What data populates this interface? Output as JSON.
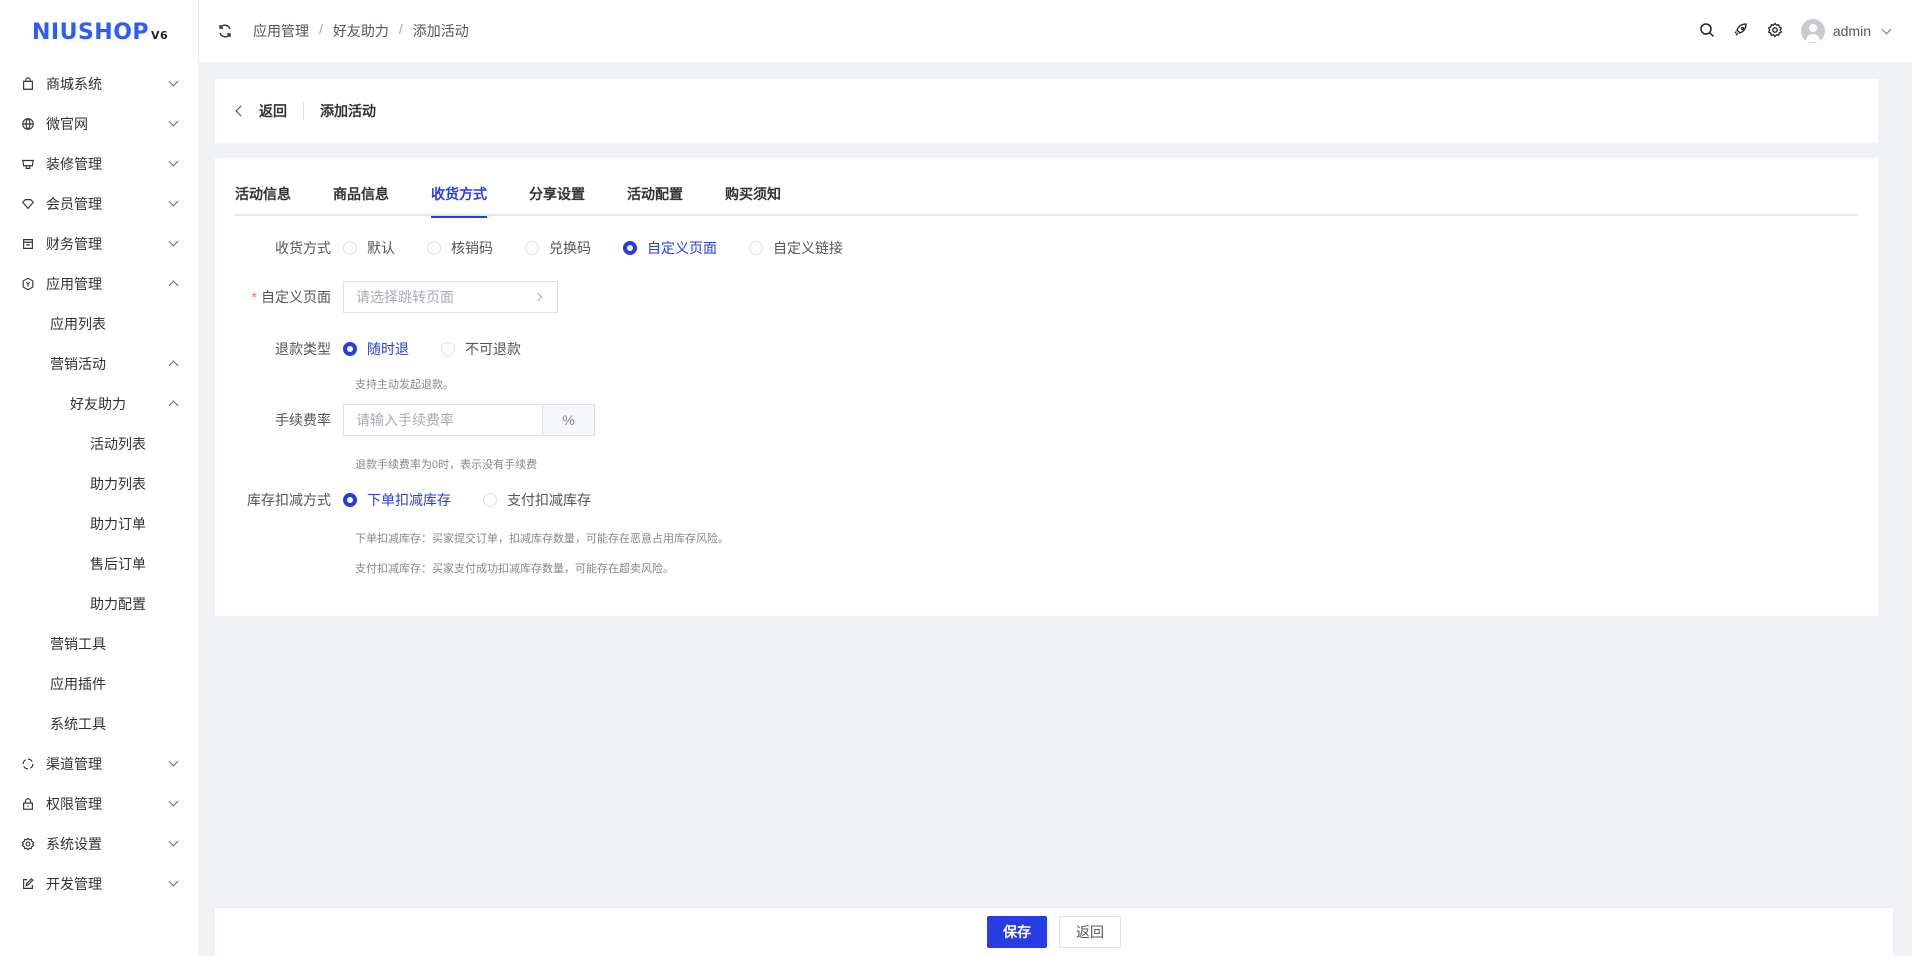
{
  "logo": {
    "text": "NIUSHOP",
    "version": "V6"
  },
  "sidebar": {
    "items": [
      {
        "label": "商城系统",
        "icon": "bag-icon",
        "level": 1,
        "expanded": false
      },
      {
        "label": "微官网",
        "icon": "globe-icon",
        "level": 1,
        "expanded": false
      },
      {
        "label": "装修管理",
        "icon": "decor-icon",
        "level": 1,
        "expanded": false
      },
      {
        "label": "会员管理",
        "icon": "diamond-icon",
        "level": 1,
        "expanded": false
      },
      {
        "label": "财务管理",
        "icon": "finance-icon",
        "level": 1,
        "expanded": false
      },
      {
        "label": "应用管理",
        "icon": "cube-icon",
        "level": 1,
        "expanded": true
      },
      {
        "label": "应用列表",
        "level": 2
      },
      {
        "label": "营销活动",
        "level": 2,
        "expanded": true
      },
      {
        "label": "好友助力",
        "level": 3,
        "expanded": true
      },
      {
        "label": "活动列表",
        "level": 4
      },
      {
        "label": "助力列表",
        "level": 4
      },
      {
        "label": "助力订单",
        "level": 4
      },
      {
        "label": "售后订单",
        "level": 4
      },
      {
        "label": "助力配置",
        "level": 4
      },
      {
        "label": "营销工具",
        "level": 2
      },
      {
        "label": "应用插件",
        "level": 2
      },
      {
        "label": "系统工具",
        "level": 2
      },
      {
        "label": "渠道管理",
        "icon": "channel-icon",
        "level": 1,
        "expanded": false
      },
      {
        "label": "权限管理",
        "icon": "lock-icon",
        "level": 1,
        "expanded": false
      },
      {
        "label": "系统设置",
        "icon": "gear-icon",
        "level": 1,
        "expanded": false
      },
      {
        "label": "开发管理",
        "icon": "edit-icon",
        "level": 1,
        "expanded": false
      }
    ]
  },
  "header": {
    "breadcrumb": [
      "应用管理",
      "好友助力",
      "添加活动"
    ],
    "user": "admin"
  },
  "page": {
    "back": "返回",
    "title": "添加活动"
  },
  "tabs": [
    {
      "label": "活动信息"
    },
    {
      "label": "商品信息"
    },
    {
      "label": "收货方式",
      "active": true
    },
    {
      "label": "分享设置"
    },
    {
      "label": "活动配置"
    },
    {
      "label": "购买须知"
    }
  ],
  "form": {
    "delivery": {
      "label": "收货方式",
      "options": [
        "默认",
        "核销码",
        "兑换码",
        "自定义页面",
        "自定义链接"
      ],
      "selected": 3
    },
    "custom_page": {
      "label": "自定义页面",
      "placeholder": "请选择跳转页面"
    },
    "refund": {
      "label": "退款类型",
      "options": [
        "随时退",
        "不可退款"
      ],
      "selected": 0,
      "hint": "支持主动发起退款。"
    },
    "fee": {
      "label": "手续费率",
      "placeholder": "请输入手续费率",
      "suffix": "%",
      "hint": "退款手续费率为0时，表示没有手续费"
    },
    "stock": {
      "label": "库存扣减方式",
      "options": [
        "下单扣减库存",
        "支付扣减库存"
      ],
      "selected": 0,
      "hint1": "下单扣减库存：买家提交订单，扣减库存数量，可能存在恶意占用库存风险。",
      "hint2": "支付扣减库存：买家支付成功扣减库存数量，可能存在超卖风险。"
    }
  },
  "footer": {
    "save": "保存",
    "back": "返回"
  },
  "colors": {
    "primary": "#273ce2",
    "logo": "#2d5cf6"
  }
}
